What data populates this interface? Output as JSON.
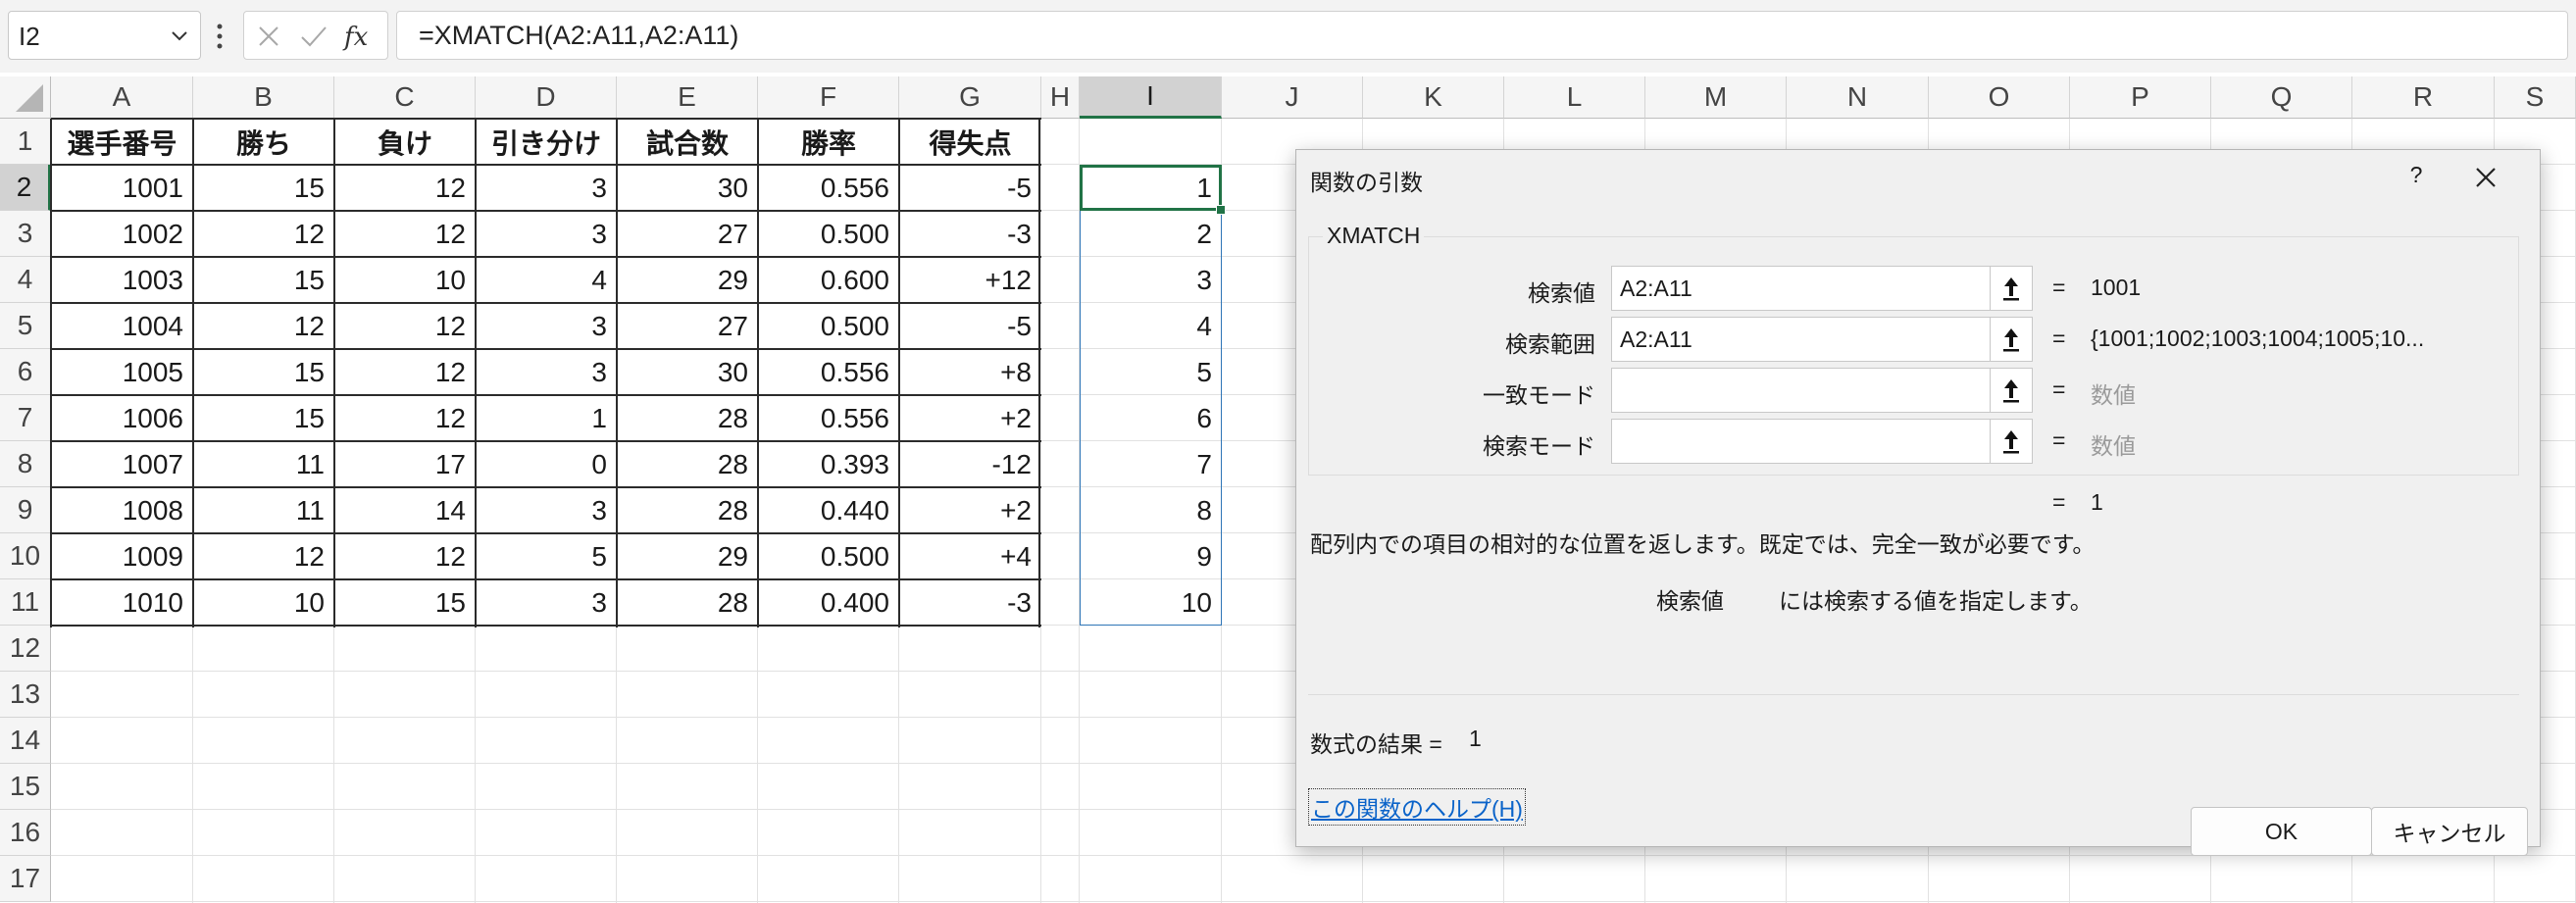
{
  "formula_bar": {
    "name_box": "I2",
    "formula": "=XMATCH(A2:A11,A2:A11)",
    "cancel_icon": "x-icon",
    "enter_icon": "check-icon",
    "function_icon": "fx-icon"
  },
  "columns": [
    "A",
    "B",
    "C",
    "D",
    "E",
    "F",
    "G",
    "H",
    "I",
    "J",
    "K",
    "L",
    "M",
    "N",
    "O",
    "P",
    "Q",
    "R",
    "S"
  ],
  "rows": [
    "1",
    "2",
    "3",
    "4",
    "5",
    "6",
    "7",
    "8",
    "9",
    "10",
    "11",
    "12",
    "13",
    "14",
    "15",
    "16",
    "17"
  ],
  "table": {
    "headers": [
      "選手番号",
      "勝ち",
      "負け",
      "引き分け",
      "試合数",
      "勝率",
      "得失点"
    ],
    "rows": [
      [
        "1001",
        "15",
        "12",
        "3",
        "30",
        "0.556",
        "-5"
      ],
      [
        "1002",
        "12",
        "12",
        "3",
        "27",
        "0.500",
        "-3"
      ],
      [
        "1003",
        "15",
        "10",
        "4",
        "29",
        "0.600",
        "+12"
      ],
      [
        "1004",
        "12",
        "12",
        "3",
        "27",
        "0.500",
        "-5"
      ],
      [
        "1005",
        "15",
        "12",
        "3",
        "30",
        "0.556",
        "+8"
      ],
      [
        "1006",
        "15",
        "12",
        "1",
        "28",
        "0.556",
        "+2"
      ],
      [
        "1007",
        "11",
        "17",
        "0",
        "28",
        "0.393",
        "-12"
      ],
      [
        "1008",
        "11",
        "14",
        "3",
        "28",
        "0.440",
        "+2"
      ],
      [
        "1009",
        "12",
        "12",
        "5",
        "29",
        "0.500",
        "+4"
      ],
      [
        "1010",
        "10",
        "15",
        "3",
        "28",
        "0.400",
        "-3"
      ]
    ]
  },
  "spill_results": [
    "1",
    "2",
    "3",
    "4",
    "5",
    "6",
    "7",
    "8",
    "9",
    "10"
  ],
  "dialog": {
    "title": "関数の引数",
    "help_glyph": "?",
    "function_name": "XMATCH",
    "args": [
      {
        "label": "検索値",
        "value": "A2:A11",
        "result": "1001",
        "placeholder": false
      },
      {
        "label": "検索範囲",
        "value": "A2:A11",
        "result": "{1001;1002;1003;1004;1005;10...",
        "placeholder": false
      },
      {
        "label": "一致モード",
        "value": "",
        "result": "数値",
        "placeholder": true
      },
      {
        "label": "検索モード",
        "value": "",
        "result": "数値",
        "placeholder": true
      }
    ],
    "equals": "=",
    "overall_result": "1",
    "description": "配列内での項目の相対的な位置を返します。既定では、完全一致が必要です。",
    "arg_description_name": "検索値",
    "arg_description_text": "には検索する値を指定します。",
    "formula_result_label": "数式の結果 =",
    "formula_result_value": "1",
    "help_link": "この関数のヘルプ(H)",
    "ok_label": "OK",
    "cancel_label": "キャンセル",
    "ref_icon": "collapse-arrow-icon"
  },
  "colors": {
    "accent_green": "#217346",
    "spill_blue": "#2e75b6",
    "link_blue": "#0a63c9"
  }
}
